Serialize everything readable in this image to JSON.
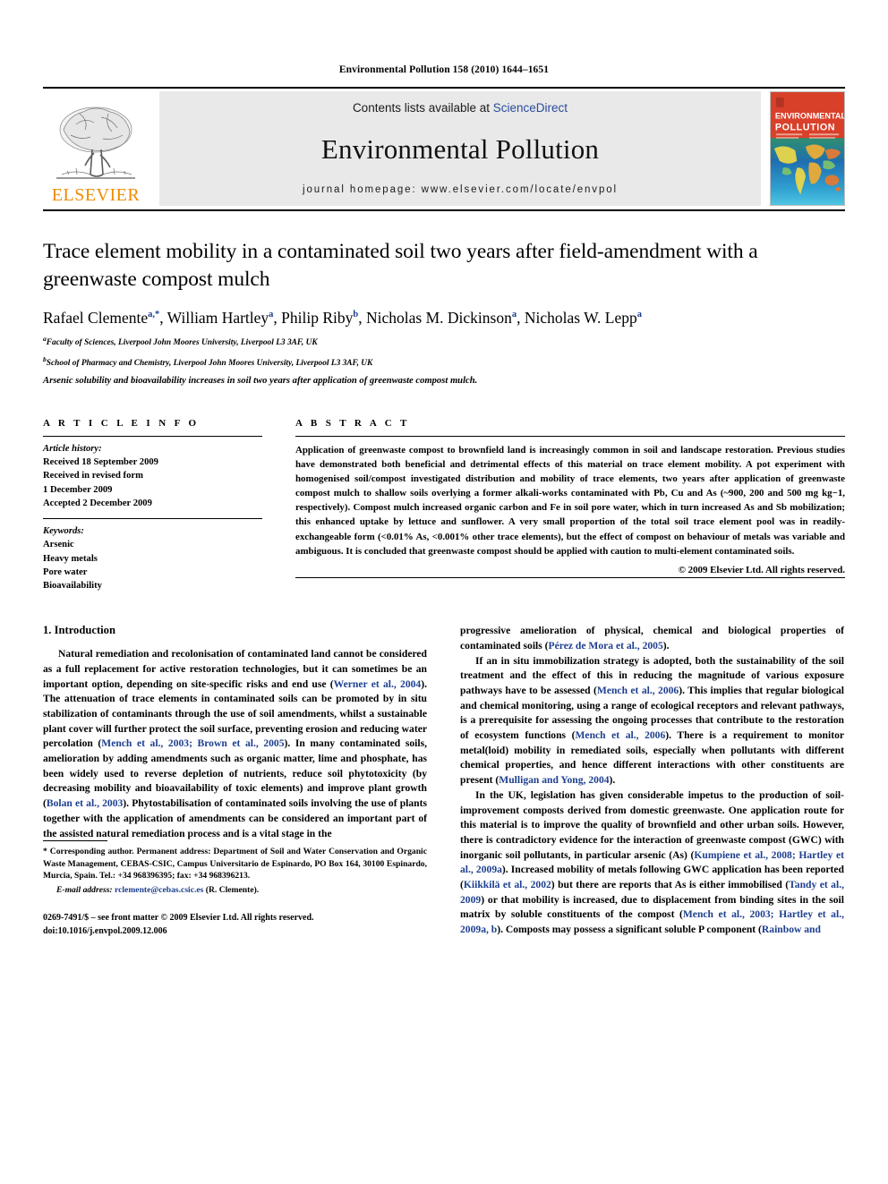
{
  "running_head": "Environmental Pollution 158 (2010) 1644–1651",
  "masthead": {
    "publisher_name": "ELSEVIER",
    "contents_prefix": "Contents lists available at ",
    "sciencedirect": "ScienceDirect",
    "journal_title": "Environmental Pollution",
    "homepage": "journal homepage: www.elsevier.com/locate/envpol",
    "cover": {
      "line1": "ENVIRONMENTAL",
      "line2": "POLLUTION",
      "accent_color": "#d9402a"
    },
    "link_color": "#2a4b9b"
  },
  "article": {
    "title": "Trace element mobility in a contaminated soil two years after field-amendment with a greenwaste compost mulch",
    "authors": [
      {
        "name": "Rafael Clemente",
        "marks": "a,*"
      },
      {
        "name": "William Hartley",
        "marks": "a"
      },
      {
        "name": "Philip Riby",
        "marks": "b"
      },
      {
        "name": "Nicholas M. Dickinson",
        "marks": "a"
      },
      {
        "name": "Nicholas W. Lepp",
        "marks": "a"
      }
    ],
    "affiliations": [
      {
        "mark": "a",
        "text": "Faculty of Sciences, Liverpool John Moores University, Liverpool L3 3AF, UK"
      },
      {
        "mark": "b",
        "text": "School of Pharmacy and Chemistry, Liverpool John Moores University, Liverpool L3 3AF, UK"
      }
    ],
    "highlight": "Arsenic solubility and bioavailability increases in soil two years after application of greenwaste compost mulch."
  },
  "article_info": {
    "heading": "A R T I C L E  I N F O",
    "history_label": "Article history:",
    "history": [
      "Received 18 September 2009",
      "Received in revised form",
      "1 December 2009",
      "Accepted 2 December 2009"
    ],
    "keywords_label": "Keywords:",
    "keywords": [
      "Arsenic",
      "Heavy metals",
      "Pore water",
      "Bioavailability"
    ]
  },
  "abstract": {
    "heading": "A B S T R A C T",
    "text": "Application of greenwaste compost to brownfield land is increasingly common in soil and landscape restoration. Previous studies have demonstrated both beneficial and detrimental effects of this material on trace element mobility. A pot experiment with homogenised soil/compost investigated distribution and mobility of trace elements, two years after application of greenwaste compost mulch to shallow soils overlying a former alkali-works contaminated with Pb, Cu and As (~900, 200 and 500 mg kg−1, respectively). Compost mulch increased organic carbon and Fe in soil pore water, which in turn increased As and Sb mobilization; this enhanced uptake by lettuce and sunflower. A very small proportion of the total soil trace element pool was in readily-exchangeable form (<0.01% As, <0.001% other trace elements), but the effect of compost on behaviour of metals was variable and ambiguous. It is concluded that greenwaste compost should be applied with caution to multi-element contaminated soils.",
    "copyright": "© 2009 Elsevier Ltd. All rights reserved."
  },
  "introduction": {
    "section_number_title": "1. Introduction",
    "left_paragraphs": [
      {
        "runs": [
          {
            "t": "Natural remediation and recolonisation of contaminated land cannot be considered as a full replacement for active restoration technologies, but it can sometimes be an important option, depending on site-specific risks and end use ("
          },
          {
            "t": "Werner et al., 2004",
            "cite": true
          },
          {
            "t": "). The attenuation of trace elements in contaminated soils can be promoted by in situ stabilization of contaminants through the use of soil amendments, whilst a sustainable plant cover will further protect the soil surface, preventing erosion and reducing water percolation ("
          },
          {
            "t": "Mench et al., 2003; Brown et al., 2005",
            "cite": true
          },
          {
            "t": "). In many contaminated soils, amelioration by adding amendments such as organic matter, lime and phosphate, has been widely used to reverse depletion of nutrients, reduce soil phytotoxicity (by decreasing mobility and bioavailability of toxic elements) and improve plant growth ("
          },
          {
            "t": "Bolan et al., 2003",
            "cite": true
          },
          {
            "t": "). Phytostabilisation of contaminated soils involving the use of plants together with the application of amendments can be considered an important part of the assisted natural remediation process and is a vital stage in the"
          }
        ]
      }
    ],
    "right_paragraphs": [
      {
        "runs": [
          {
            "t": "progressive amelioration of physical, chemical and biological properties of contaminated soils ("
          },
          {
            "t": "Pérez de Mora et al., 2005",
            "cite": true
          },
          {
            "t": ")."
          }
        ],
        "continuation": true
      },
      {
        "runs": [
          {
            "t": "If an in situ immobilization strategy is adopted, both the sustainability of the soil treatment and the effect of this in reducing the magnitude of various exposure pathways have to be assessed ("
          },
          {
            "t": "Mench et al., 2006",
            "cite": true
          },
          {
            "t": "). This implies that regular biological and chemical monitoring, using a range of ecological receptors and relevant pathways, is a prerequisite for assessing the ongoing processes that contribute to the restoration of ecosystem functions ("
          },
          {
            "t": "Mench et al., 2006",
            "cite": true
          },
          {
            "t": "). There is a requirement to monitor metal(loid) mobility in remediated soils, especially when pollutants with different chemical properties, and hence different interactions with other constituents are present ("
          },
          {
            "t": "Mulligan and Yong, 2004",
            "cite": true
          },
          {
            "t": ")."
          }
        ]
      },
      {
        "runs": [
          {
            "t": "In the UK, legislation has given considerable impetus to the production of soil- improvement composts derived from domestic greenwaste. One application route for this material is to improve the quality of brownfield and other urban soils. However, there is contradictory evidence for the interaction of greenwaste compost (GWC) with inorganic soil pollutants, in particular arsenic (As) ("
          },
          {
            "t": "Kumpiene et al., 2008; Hartley et al., 2009a",
            "cite": true
          },
          {
            "t": "). Increased mobility of metals following GWC application has been reported ("
          },
          {
            "t": "Kiikkilä et al., 2002",
            "cite": true
          },
          {
            "t": ") but there are reports that As is either immobilised ("
          },
          {
            "t": "Tandy et al., 2009",
            "cite": true
          },
          {
            "t": ") or that mobility is increased, due to displacement from binding sites in the soil matrix by soluble constituents of the compost ("
          },
          {
            "t": "Mench et al., 2003; Hartley et al., 2009a, b",
            "cite": true
          },
          {
            "t": "). Composts may possess a significant soluble P component ("
          },
          {
            "t": "Rainbow and",
            "cite": true
          }
        ]
      }
    ]
  },
  "footnotes": {
    "corresponding": "* Corresponding author. Permanent address: Department of Soil and Water Conservation and Organic Waste Management, CEBAS-CSIC, Campus Universitario de Espinardo, PO Box 164, 30100 Espinardo, Murcia, Spain. Tel.: +34 968396395; fax: +34 968396213.",
    "email_label": "E-mail address:",
    "email": "rclemente@cebas.csic.es",
    "email_suffix": "(R. Clemente).",
    "issn_line": "0269-7491/$ – see front matter © 2009 Elsevier Ltd. All rights reserved.",
    "doi_line": "doi:10.1016/j.envpol.2009.12.006"
  }
}
